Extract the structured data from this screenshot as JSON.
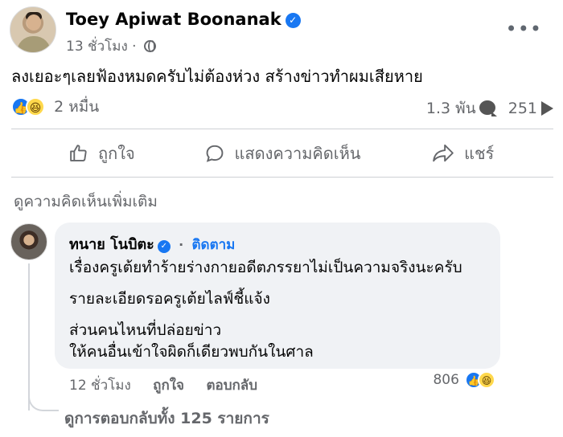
{
  "post": {
    "author": "Toey Apiwat Boonanak",
    "time": "13 ชั่วโมง",
    "text": "ลงเยอะๆเลยฟ้องหมดครับไม่ต้องห่วง สร้างข่าวทำผมเสียหาย",
    "reaction_count": "2 หมื่น",
    "comment_count": "1.3 พัน",
    "share_count": "251",
    "more_icon": "more-options-icon"
  },
  "actions": {
    "like": "ถูกใจ",
    "comment": "แสดงความคิดเห็น",
    "share": "แชร์"
  },
  "comments_section": {
    "more_comments": "ดูความคิดเห็นเพิ่มเติม",
    "comment": {
      "author": "ทนาย โนบิตะ",
      "follow": "ติดตาม",
      "lines": [
        "เรื่องครูเต้ยทำร้ายร่างกายอดีตภรรยาไม่เป็นความจริงนะครับ",
        "รายละเอียดรอครูเต้ยไลฟ์ชี้แจ้ง",
        "ส่วนคนไหนที่ปล่อยข่าว",
        "ให้คนอื่นเข้าใจผิดก็เดียวพบกันในศาล"
      ],
      "time": "12 ชั่วโมง",
      "like": "ถูกใจ",
      "reply": "ตอบกลับ",
      "reaction_count": "806"
    },
    "view_replies": "ดูการตอบกลับทั้ง 125 รายการ"
  },
  "colors": {
    "brand_blue": "#1877f2",
    "meta_gray": "#65676b",
    "comment_bg": "#f0f2f5"
  }
}
